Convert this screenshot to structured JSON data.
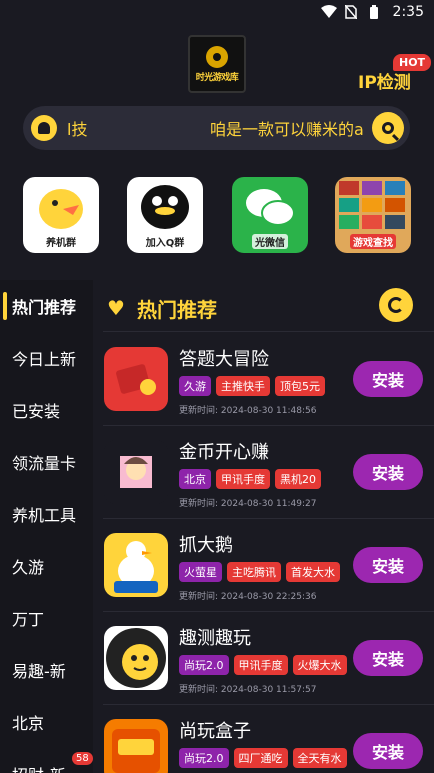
{
  "status": {
    "time": "2:35"
  },
  "header": {
    "logo_text": "时光游戏库",
    "ip_check_label": "IP检测",
    "hot_badge": "HOT"
  },
  "search": {
    "left_text": "l技",
    "marquee_text": "咱是一款可以赚米的a"
  },
  "shortcuts": [
    {
      "label": "养机群",
      "bg": "#ffd43b"
    },
    {
      "label": "加入Q群",
      "bg": "#111111"
    },
    {
      "label": "光微信",
      "bg": "#2bb34a"
    },
    {
      "label": "游戏查找",
      "bg": "#e0a85a"
    }
  ],
  "sidebar": {
    "items": [
      {
        "label": "热门推荐"
      },
      {
        "label": "今日上新"
      },
      {
        "label": "已安装"
      },
      {
        "label": "领流量卡"
      },
      {
        "label": "养机工具"
      },
      {
        "label": "久游"
      },
      {
        "label": "万丁"
      },
      {
        "label": "易趣-新"
      },
      {
        "label": "北京"
      },
      {
        "label": "招财-新"
      }
    ],
    "badge": "58"
  },
  "section": {
    "title": "热门推荐"
  },
  "apps": [
    {
      "name": "答题大冒险",
      "tags": [
        {
          "text": "久游",
          "color": "purple"
        },
        {
          "text": "主推快手",
          "color": "red"
        },
        {
          "text": "顶包5元",
          "color": "red"
        }
      ],
      "update": "更新时间: 2024-08-30 11:48:56",
      "install": "安装",
      "icon_bg": "#e53935"
    },
    {
      "name": "金币开心赚",
      "tags": [
        {
          "text": "北京",
          "color": "purple"
        },
        {
          "text": "甲讯手度",
          "color": "red"
        },
        {
          "text": "黑机20",
          "color": "red"
        }
      ],
      "update": "更新时间: 2024-08-30 11:49:27",
      "install": "安装",
      "icon_bg": "#1a1a22"
    },
    {
      "name": "抓大鹅",
      "tags": [
        {
          "text": "火萤星",
          "color": "purple"
        },
        {
          "text": "主吃腾讯",
          "color": "red"
        },
        {
          "text": "首发大水",
          "color": "red"
        }
      ],
      "update": "更新时间: 2024-08-30 22:25:36",
      "install": "安装",
      "icon_bg": "#ffd43b"
    },
    {
      "name": "趣测趣玩",
      "tags": [
        {
          "text": "尚玩2.0",
          "color": "purple"
        },
        {
          "text": "甲讯手度",
          "color": "red"
        },
        {
          "text": "火爆大水",
          "color": "red"
        }
      ],
      "update": "更新时间: 2024-08-30 11:57:57",
      "install": "安装",
      "icon_bg": "#ffffff"
    },
    {
      "name": "尚玩盒子",
      "tags": [
        {
          "text": "尚玩2.0",
          "color": "purple"
        },
        {
          "text": "四厂通吃",
          "color": "red"
        },
        {
          "text": "全天有水",
          "color": "red"
        }
      ],
      "update": "",
      "install": "安装",
      "icon_bg": "#f57c00"
    }
  ]
}
